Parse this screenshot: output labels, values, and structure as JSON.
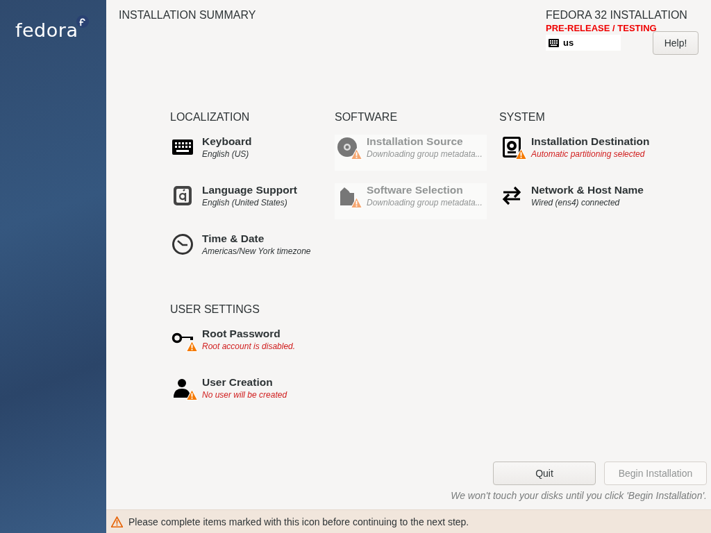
{
  "sidebar": {
    "logo": "fedora"
  },
  "header": {
    "title": "INSTALLATION SUMMARY",
    "product": "FEDORA 32 INSTALLATION",
    "prerelease": "PRE-RELEASE / TESTING",
    "keyboard_layout": "us",
    "help_button": "Help!"
  },
  "sections": [
    {
      "title": "LOCALIZATION",
      "spokes": [
        {
          "kind": "keyboard",
          "title": "Keyboard",
          "status": "English (US)",
          "warning": false,
          "status_warning": false,
          "disabled": false
        },
        {
          "kind": "language",
          "title": "Language Support",
          "status": "English (United States)",
          "warning": false,
          "status_warning": false,
          "disabled": false
        },
        {
          "kind": "clock",
          "title": "Time & Date",
          "status": "Americas/New York timezone",
          "warning": false,
          "status_warning": false,
          "disabled": false
        }
      ]
    },
    {
      "title": "SOFTWARE",
      "spokes": [
        {
          "kind": "disc",
          "title": "Installation Source",
          "status": "Downloading group metadata...",
          "warning": true,
          "status_warning": false,
          "disabled": true
        },
        {
          "kind": "package",
          "title": "Software Selection",
          "status": "Downloading group metadata...",
          "warning": true,
          "status_warning": false,
          "disabled": true
        }
      ]
    },
    {
      "title": "SYSTEM",
      "spokes": [
        {
          "kind": "disk",
          "title": "Installation Destination",
          "status": "Automatic partitioning selected",
          "warning": true,
          "status_warning": true,
          "disabled": false
        },
        {
          "kind": "network",
          "title": "Network & Host Name",
          "status": "Wired (ens4) connected",
          "warning": false,
          "status_warning": false,
          "disabled": false
        }
      ]
    },
    {
      "title": "USER SETTINGS",
      "spokes": [
        {
          "kind": "key",
          "title": "Root Password",
          "status": "Root account is disabled.",
          "warning": true,
          "status_warning": true,
          "disabled": false
        },
        {
          "kind": "user",
          "title": "User Creation",
          "status": "No user will be created",
          "warning": true,
          "status_warning": true,
          "disabled": false
        }
      ]
    }
  ],
  "buttons": [
    {
      "label": "Quit",
      "disabled": false
    },
    {
      "label": "Begin Installation",
      "disabled": true
    }
  ],
  "note": "We won't touch your disks until you click 'Begin Installation'.",
  "warning_bar": "Please complete items marked with this icon before continuing to the next step."
}
